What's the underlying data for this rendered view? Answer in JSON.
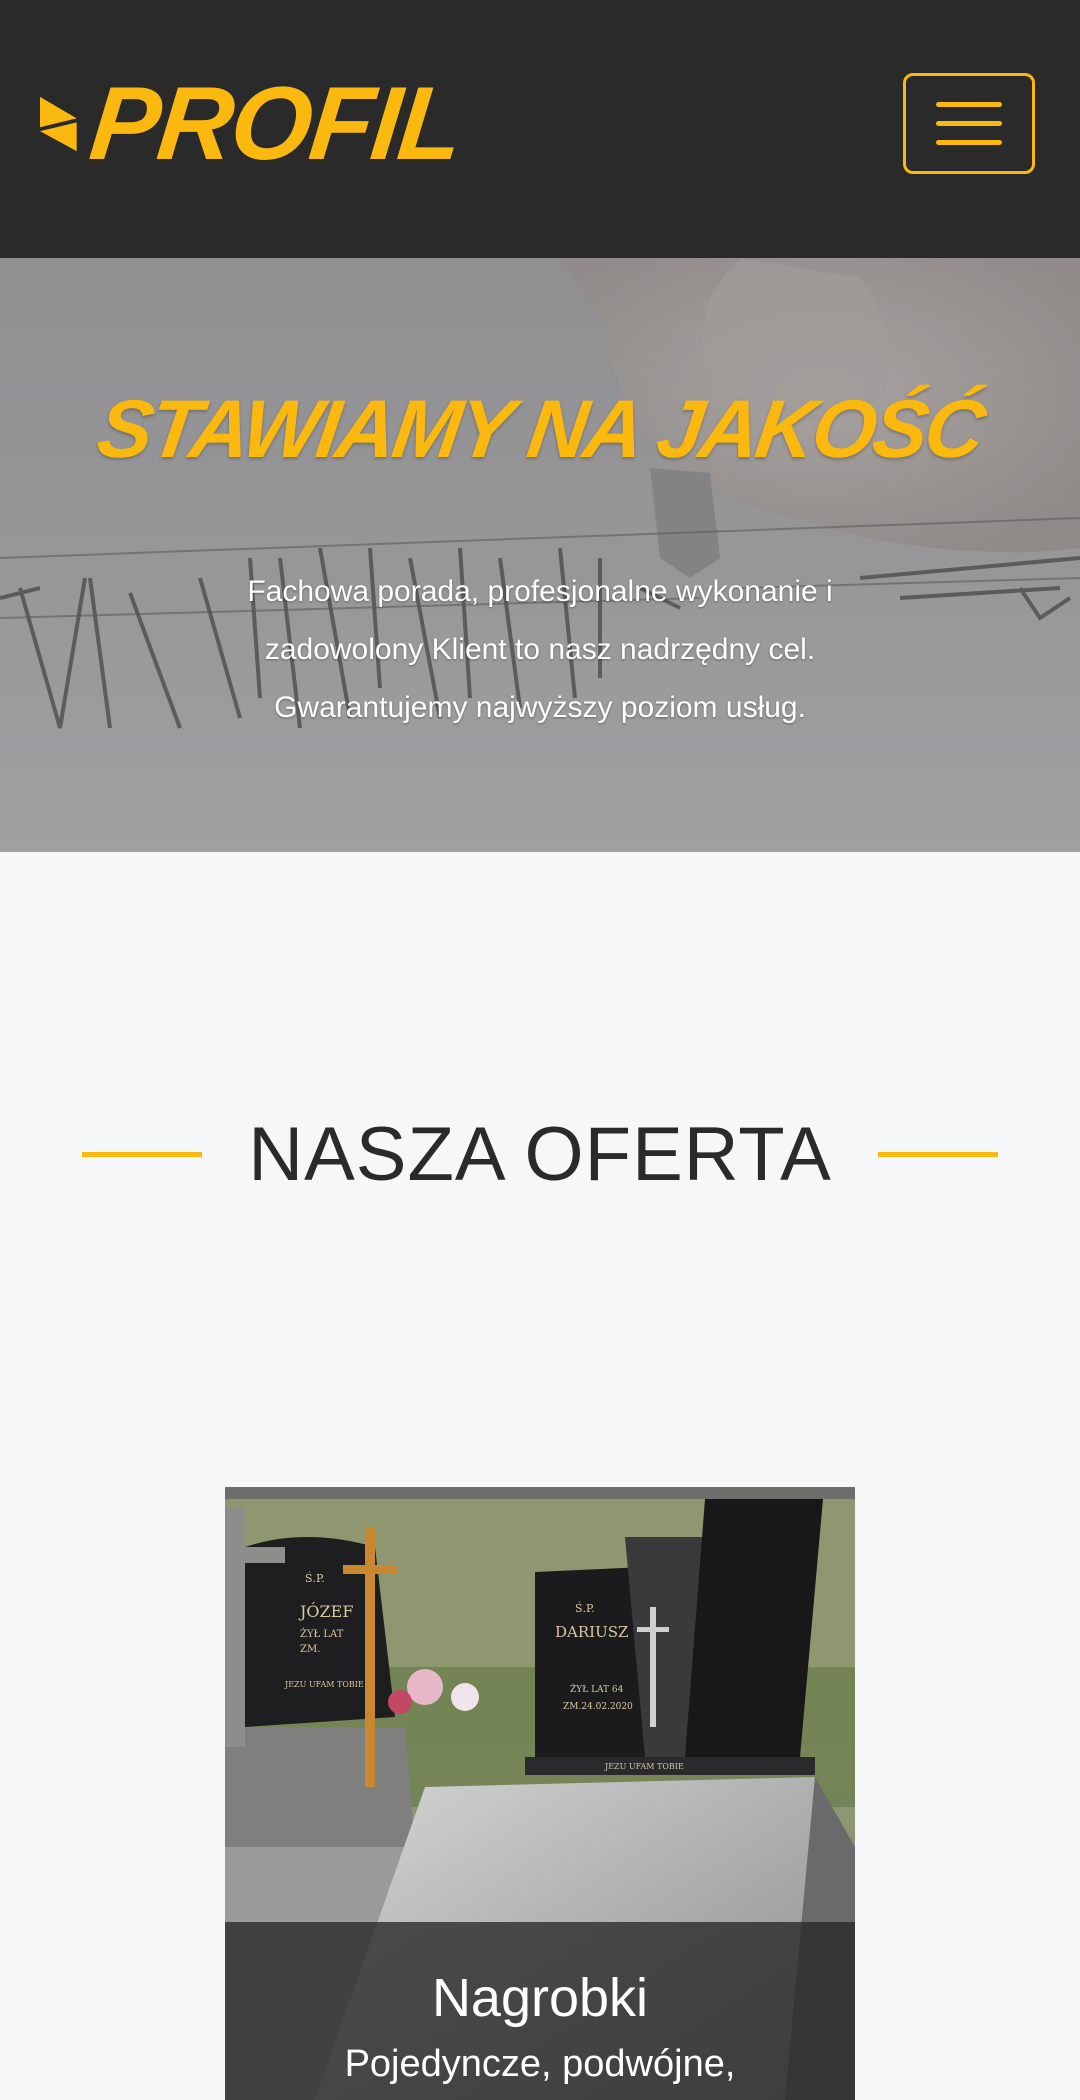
{
  "header": {
    "logo_text": "PROFIL",
    "menu_icon": "hamburger-menu-icon",
    "brand_color": "#fbb90f",
    "background_color": "#2a2a2b"
  },
  "hero": {
    "title": "STAWIAMY NA JAKOŚĆ",
    "lines": [
      "Fachowa porada, profesjonalne wykonanie i",
      "zadowolony Klient to nasz nadrzędny cel.",
      "Gwarantujemy najwyższy poziom usług."
    ]
  },
  "offer": {
    "title": "NASZA OFERTA",
    "cards": [
      {
        "title": "Nagrobki",
        "description": "Pojedyncze, podwójne,",
        "photo_text": {
          "left_header": "Ś.P.",
          "left_name": "JÓZEF",
          "left_age": "ŻYŁ LAT",
          "left_death": "ZM.",
          "left_motto": "JEZU UFAM TOBIE",
          "right_header": "Ś.P.",
          "right_name": "DARIUSZ",
          "right_age": "ŻYŁ LAT 64",
          "right_death": "ZM.24.02.2020",
          "right_motto": "JEZU UFAM TOBIE"
        }
      }
    ]
  }
}
